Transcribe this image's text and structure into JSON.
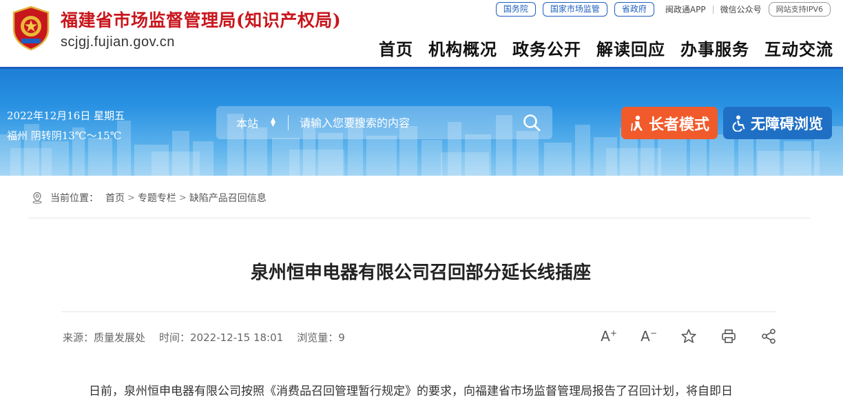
{
  "header": {
    "org_name": "福建省市场监督管理局(知识产权局)",
    "domain": "scjgj.fujian.gov.cn",
    "top_links": [
      "国务院",
      "国家市场监管",
      "省政府"
    ],
    "app_link": "闽政通APP",
    "wechat_link": "微信公众号",
    "ipv6_badge": "网站支持IPV6",
    "nav": [
      "首页",
      "机构概况",
      "政务公开",
      "解读回应",
      "办事服务",
      "互动交流"
    ]
  },
  "banner": {
    "date": "2022年12月16日 星期五",
    "weather": "福州 阴转阴13℃～15℃",
    "search_scope": "本站",
    "search_placeholder": "请输入您要搜索的内容",
    "elder_mode_label": "长者模式",
    "accessibility_label": "无障碍浏览"
  },
  "breadcrumb": {
    "prefix": "当前位置：",
    "items": [
      "首页",
      "专题专栏",
      "缺陷产品召回信息"
    ]
  },
  "article": {
    "title": "泉州恒申电器有限公司召回部分延长线插座",
    "source": "来源：质量发展处",
    "time": "时间：2022-12-15 18:01",
    "views": "浏览量：9",
    "body_first_line": "日前，泉州恒申电器有限公司按照《消费品召回管理暂行规定》的要求，向福建省市场监督管理局报告了召回计划，将自即日"
  },
  "colors": {
    "brand_red": "#c8161d",
    "brand_blue": "#1e5fbf",
    "elder_orange": "#f15a2b",
    "access_blue": "#1f6fc5"
  },
  "icons": [
    "emblem-icon",
    "search-icon",
    "elder-icon",
    "wheelchair-icon",
    "location-icon",
    "font-increase-icon",
    "font-decrease-icon",
    "star-icon",
    "print-icon",
    "share-icon"
  ]
}
